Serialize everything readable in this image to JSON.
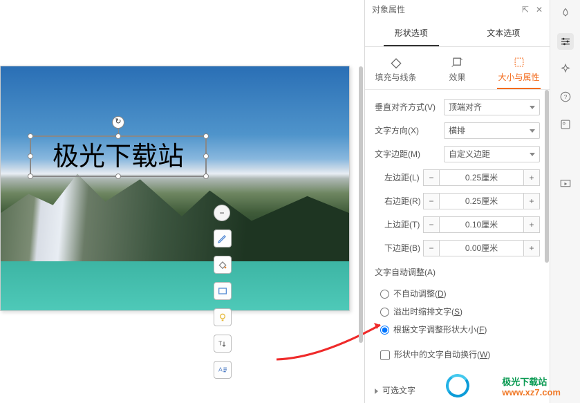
{
  "panel": {
    "title": "对象属性",
    "tabs": {
      "shape": "形状选项",
      "text": "文本选项"
    },
    "subtabs": {
      "fill": "填充与线条",
      "effect": "效果",
      "size": "大小与属性"
    }
  },
  "props": {
    "valign": {
      "label": "垂直对齐方式(V)",
      "value": "顶端对齐"
    },
    "direction": {
      "label": "文字方向(X)",
      "value": "横排"
    },
    "margin": {
      "label": "文字边距(M)",
      "value": "自定义边距"
    },
    "left": {
      "label": "左边距(L)",
      "value": "0.25厘米"
    },
    "right": {
      "label": "右边距(R)",
      "value": "0.25厘米"
    },
    "top": {
      "label": "上边距(T)",
      "value": "0.10厘米"
    },
    "bottom": {
      "label": "下边距(B)",
      "value": "0.00厘米"
    },
    "autofit": {
      "title": "文字自动调整(A)",
      "none": "不自动调整(D)",
      "shrink": "溢出时缩排文字(S)",
      "resize": "根据文字调整形状大小(F)"
    },
    "wrap": "形状中的文字自动换行(W)",
    "alttext": "可选文字"
  },
  "canvas": {
    "textbox": "极光下载站"
  },
  "watermark": {
    "name": "极光下载站",
    "url": "www.xz7.com"
  },
  "glyph": {
    "minus": "−",
    "plus": "+",
    "pin": "⇱",
    "close": "✕",
    "rotate": "↻"
  }
}
